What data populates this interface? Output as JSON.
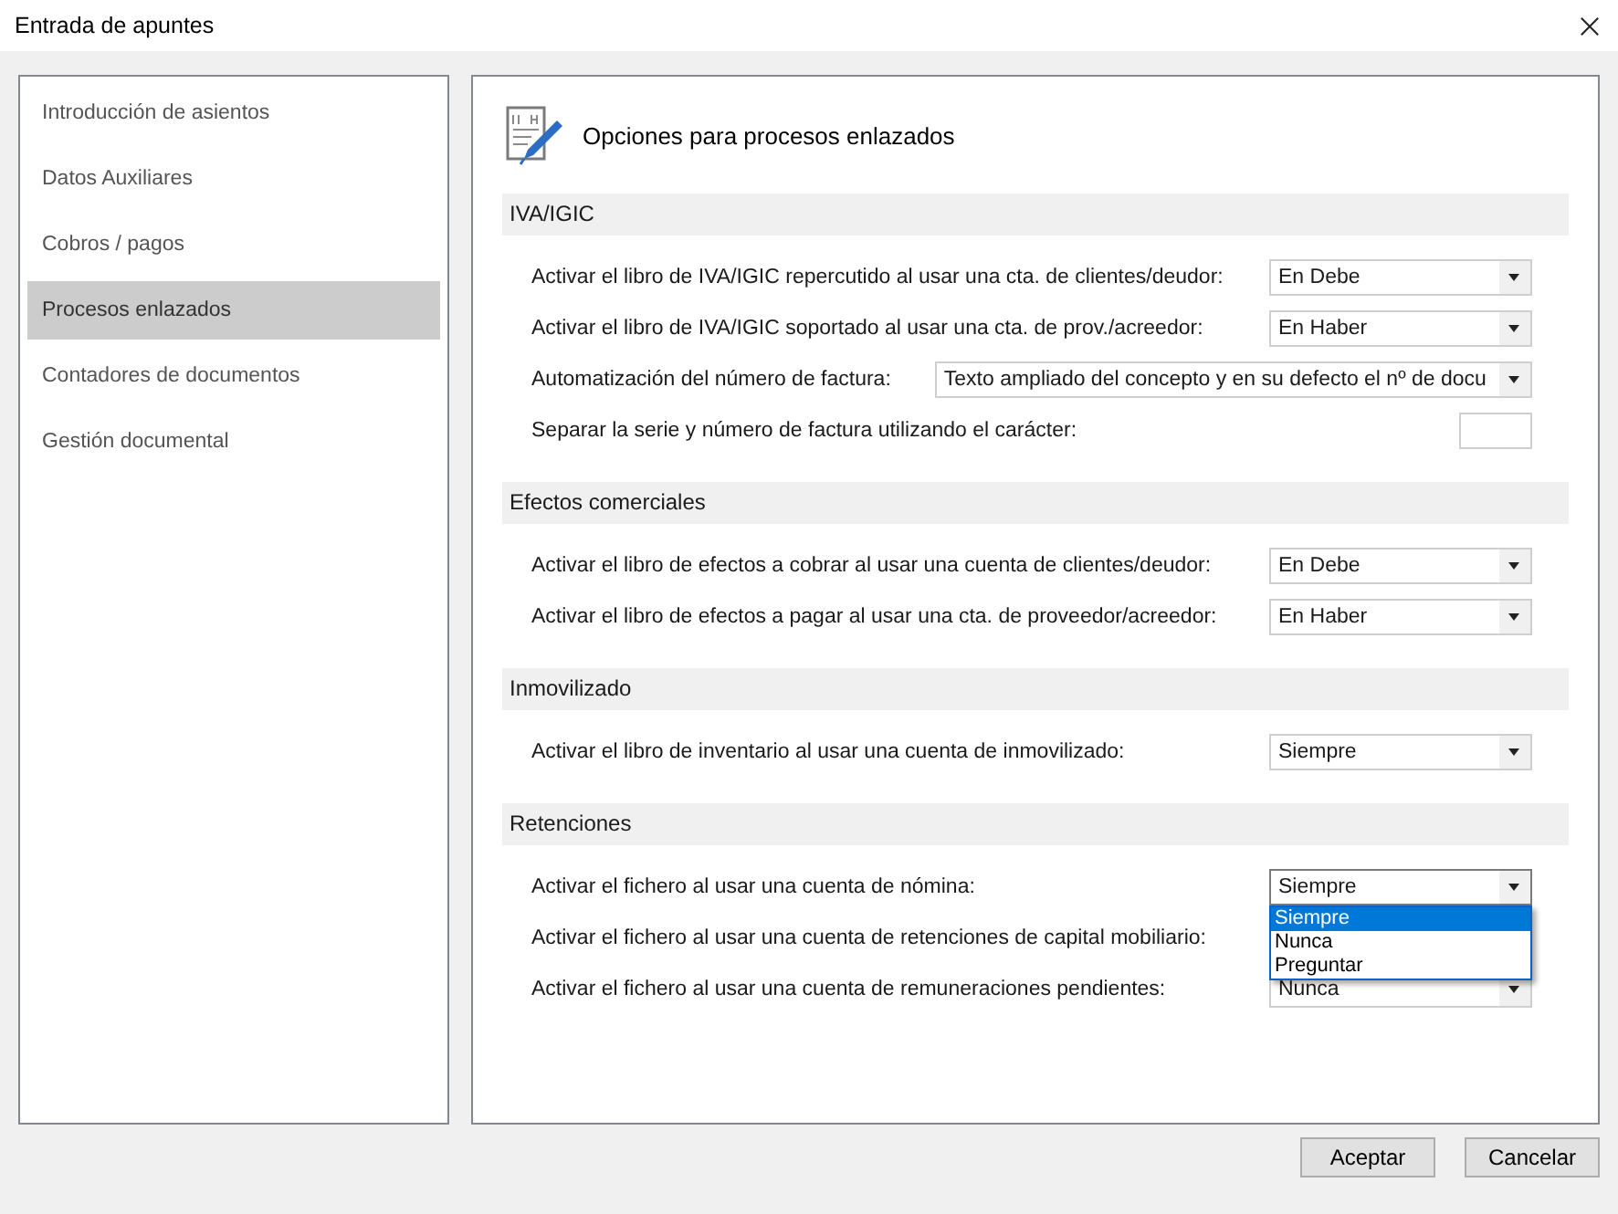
{
  "window": {
    "title": "Entrada de apuntes"
  },
  "sidebar": {
    "items": [
      {
        "label": "Introducción de asientos",
        "selected": false
      },
      {
        "label": "Datos Auxiliares",
        "selected": false
      },
      {
        "label": "Cobros / pagos",
        "selected": false
      },
      {
        "label": "Procesos enlazados",
        "selected": true
      },
      {
        "label": "Contadores de documentos",
        "selected": false
      },
      {
        "label": "Gestión documental",
        "selected": false
      }
    ]
  },
  "panel": {
    "title": "Opciones para procesos enlazados",
    "sections": [
      {
        "title": "IVA/IGIC",
        "rows": [
          {
            "kind": "select",
            "label": "Activar el libro de IVA/IGIC repercutido al usar una cta. de clientes/deudor:",
            "value": "En Debe"
          },
          {
            "kind": "select",
            "label": "Activar el libro de IVA/IGIC soportado al usar una cta. de prov./acreedor:",
            "value": "En Haber"
          },
          {
            "kind": "wide-select",
            "label": "Automatización del número de factura:",
            "value": "Texto ampliado del concepto y en su defecto el nº de docu"
          },
          {
            "kind": "text",
            "label": "Separar la serie y número de factura utilizando el carácter:"
          }
        ]
      },
      {
        "title": "Efectos comerciales",
        "rows": [
          {
            "kind": "select",
            "label": "Activar el libro de efectos a cobrar al usar una cuenta de clientes/deudor:",
            "value": "En Debe"
          },
          {
            "kind": "select",
            "label": "Activar el libro de efectos a pagar al usar una cta. de proveedor/acreedor:",
            "value": "En Haber"
          }
        ]
      },
      {
        "title": "Inmovilizado",
        "rows": [
          {
            "kind": "select",
            "label": "Activar el libro de inventario al usar una cuenta de inmovilizado:",
            "value": "Siempre"
          }
        ]
      },
      {
        "title": "Retenciones",
        "rows": [
          {
            "kind": "select",
            "label": "Activar el fichero al usar una cuenta de nómina:",
            "value": "Siempre",
            "open": true,
            "options": [
              {
                "label": "Siempre",
                "selected": true
              },
              {
                "label": "Nunca",
                "selected": false
              },
              {
                "label": "Preguntar",
                "selected": false
              }
            ]
          },
          {
            "kind": "label",
            "label": "Activar el fichero al usar una cuenta de retenciones de capital mobiliario:"
          },
          {
            "kind": "select",
            "label": "Activar el fichero al usar una cuenta de remuneraciones pendientes:",
            "value": "Nunca"
          }
        ]
      }
    ]
  },
  "buttons": [
    "Aceptar",
    "Cancelar"
  ]
}
